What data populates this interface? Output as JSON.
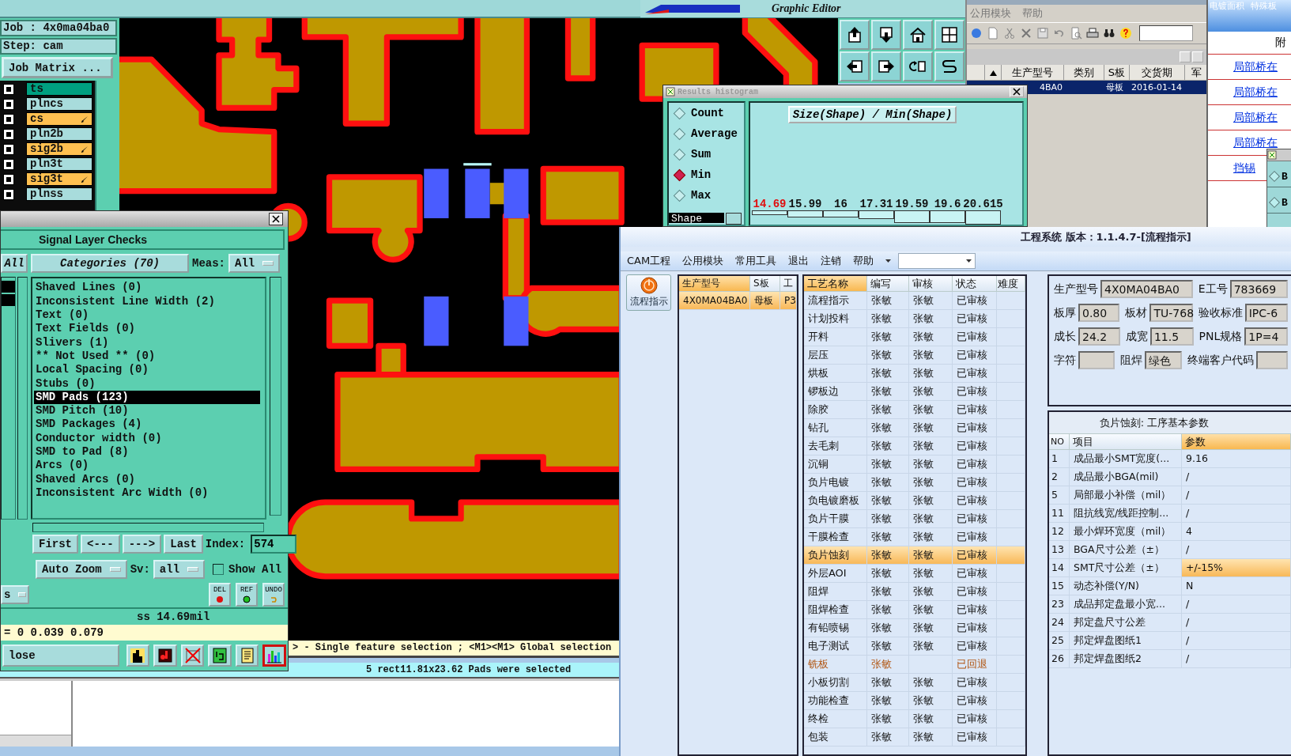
{
  "genesis": {
    "job": "Job : 4x0ma04ba0",
    "step": "Step: cam",
    "matrix_button": "Job Matrix ...",
    "layers": [
      {
        "name": "ts",
        "checked": true,
        "work": true,
        "affected": false
      },
      {
        "name": "plncs",
        "checked": true,
        "work": false,
        "affected": false
      },
      {
        "name": "cs",
        "checked": true,
        "work": false,
        "affected": true
      },
      {
        "name": "pln2b",
        "checked": true,
        "work": false,
        "affected": false
      },
      {
        "name": "sig2b",
        "checked": true,
        "work": false,
        "affected": true
      },
      {
        "name": "pln3t",
        "checked": true,
        "work": false,
        "affected": false
      },
      {
        "name": "sig3t",
        "checked": true,
        "work": false,
        "affected": true
      },
      {
        "name": "plnss",
        "checked": true,
        "work": false,
        "affected": false
      }
    ]
  },
  "editor": {
    "title": "Graphic Editor",
    "tools": [
      {
        "kind": "box-up"
      },
      {
        "kind": "box-down"
      },
      {
        "kind": "home"
      },
      {
        "kind": "grid"
      },
      {
        "kind": "box-left"
      },
      {
        "kind": "box-right"
      },
      {
        "kind": "rotate"
      },
      {
        "kind": "curve"
      }
    ]
  },
  "histogram": {
    "title": "Results histogram",
    "options": [
      {
        "label": "Count",
        "selected": false
      },
      {
        "label": "Average",
        "selected": false
      },
      {
        "label": "Sum",
        "selected": false
      },
      {
        "label": "Min",
        "selected": true
      },
      {
        "label": "Max",
        "selected": false
      }
    ],
    "list_item": "Shape",
    "heading": "Size(Shape) / Min(Shape)",
    "bars": [
      {
        "label": "14.69",
        "selected": true
      },
      {
        "label": "15.99",
        "selected": false
      },
      {
        "label": "16",
        "selected": false
      },
      {
        "label": "17.31",
        "selected": false
      },
      {
        "label": "19.59",
        "selected": false
      },
      {
        "label": "19.6",
        "selected": false
      },
      {
        "label": "20.615",
        "selected": false
      }
    ]
  },
  "checks": {
    "title": "Signal Layer Checks",
    "all_tab": "All",
    "categories_button": "Categories (70)",
    "meas_label": "Meas:",
    "meas_value": "All",
    "items": [
      {
        "label": "Shaved Lines (0)",
        "selected": false
      },
      {
        "label": "Inconsistent Line Width (2)",
        "selected": false
      },
      {
        "label": "Text (0)",
        "selected": false
      },
      {
        "label": "Text Fields (0)",
        "selected": false
      },
      {
        "label": "Slivers (1)",
        "selected": false
      },
      {
        "label": "** Not Used ** (0)",
        "selected": false
      },
      {
        "label": "Local Spacing (0)",
        "selected": false
      },
      {
        "label": "Stubs (0)",
        "selected": false
      },
      {
        "label": "SMD Pads (123)",
        "selected": true
      },
      {
        "label": "SMD Pitch (10)",
        "selected": false
      },
      {
        "label": "SMD Packages (4)",
        "selected": false
      },
      {
        "label": "Conductor width (0)",
        "selected": false
      },
      {
        "label": "SMD to Pad (8)",
        "selected": false
      },
      {
        "label": "Arcs (0)",
        "selected": false
      },
      {
        "label": "Shaved Arcs (0)",
        "selected": false
      },
      {
        "label": "Inconsistent Arc Width (0)",
        "selected": false
      }
    ],
    "nav": [
      "First",
      "<---",
      "--->",
      "Last"
    ],
    "index_label": "Index:",
    "index_value": "574",
    "zoom_value": "Auto Zoom",
    "sv_label": "Sv:",
    "sv_value": "all",
    "show_all": {
      "label": "Show All",
      "checked": false
    },
    "left_dropdown": "s",
    "actions": [
      {
        "label": "DEL",
        "kind": "delete"
      },
      {
        "label": "REF",
        "kind": "ref"
      },
      {
        "label": "UNDO",
        "kind": "undo"
      }
    ],
    "measure": "ss 14.69mil",
    "coords": "= 0 0.039 0.079",
    "close_button": "lose",
    "tools": [
      {
        "kind": "figure",
        "selected": false
      },
      {
        "kind": "layer",
        "selected": false
      },
      {
        "kind": "cross",
        "selected": false
      },
      {
        "kind": "numbered",
        "selected": false
      },
      {
        "kind": "notes",
        "selected": false
      },
      {
        "kind": "chart",
        "selected": true
      }
    ]
  },
  "status": {
    "hint": "> - Single feature selection ; <M1><M1> Global selection",
    "message": "5 rect11.81x23.62 Pads were selected"
  },
  "back_window": {
    "menu": [
      "公用模块",
      "帮助"
    ],
    "tools": [
      {
        "kind": "globe"
      },
      {
        "kind": "page"
      },
      {
        "kind": "scissors"
      },
      {
        "kind": "cross"
      },
      {
        "kind": "save"
      },
      {
        "kind": "undo"
      },
      {
        "kind": "preview"
      },
      {
        "kind": "print"
      },
      {
        "kind": "binoculars"
      },
      {
        "kind": "help"
      }
    ],
    "columns": [
      "生产型号",
      "类别",
      "S板",
      "交货期",
      "军"
    ],
    "row": {
      "selected": true,
      "cells": [
        "4BA0",
        null,
        "母板",
        "2016-01-14",
        null
      ]
    }
  },
  "side_window": {
    "tabs": [
      "电镀面积",
      "特殊板"
    ],
    "header": "附",
    "links": [
      "局部桥在",
      "局部桥在",
      "局部桥在",
      "局部桥在",
      "挡锡"
    ],
    "mini_options": [
      "B",
      "B"
    ]
  },
  "eng": {
    "title": "工程系统 版本：1.1.4.7-[流程指示]",
    "menu": [
      "CAM工程",
      "公用模块",
      "常用工具",
      "退出",
      "注销",
      "帮助"
    ],
    "side_button": "流程指示",
    "products": {
      "columns": [
        "生产型号",
        "S板",
        "工"
      ],
      "rows": [
        {
          "cells": [
            "4X0MA04BA0",
            "母板",
            "P3"
          ],
          "selected": true
        }
      ]
    },
    "processes": {
      "columns": [
        "工艺名称",
        "编写",
        "审核",
        "状态",
        "难度"
      ],
      "rows": [
        {
          "name": "流程指示",
          "writer": "张敏",
          "reviewer": "张敏",
          "status": "已审核",
          "returned": false,
          "selected": false
        },
        {
          "name": "计划投料",
          "writer": "张敏",
          "reviewer": "张敏",
          "status": "已审核",
          "returned": false,
          "selected": false
        },
        {
          "name": "开料",
          "writer": "张敏",
          "reviewer": "张敏",
          "status": "已审核",
          "returned": false,
          "selected": false
        },
        {
          "name": "层压",
          "writer": "张敏",
          "reviewer": "张敏",
          "status": "已审核",
          "returned": false,
          "selected": false
        },
        {
          "name": "烘板",
          "writer": "张敏",
          "reviewer": "张敏",
          "status": "已审核",
          "returned": false,
          "selected": false
        },
        {
          "name": "锣板边",
          "writer": "张敏",
          "reviewer": "张敏",
          "status": "已审核",
          "returned": false,
          "selected": false
        },
        {
          "name": "除胶",
          "writer": "张敏",
          "reviewer": "张敏",
          "status": "已审核",
          "returned": false,
          "selected": false
        },
        {
          "name": "钻孔",
          "writer": "张敏",
          "reviewer": "张敏",
          "status": "已审核",
          "returned": false,
          "selected": false
        },
        {
          "name": "去毛刺",
          "writer": "张敏",
          "reviewer": "张敏",
          "status": "已审核",
          "returned": false,
          "selected": false
        },
        {
          "name": "沉铜",
          "writer": "张敏",
          "reviewer": "张敏",
          "status": "已审核",
          "returned": false,
          "selected": false
        },
        {
          "name": "负片电镀",
          "writer": "张敏",
          "reviewer": "张敏",
          "status": "已审核",
          "returned": false,
          "selected": false
        },
        {
          "name": "负电镀磨板",
          "writer": "张敏",
          "reviewer": "张敏",
          "status": "已审核",
          "returned": false,
          "selected": false
        },
        {
          "name": "负片干膜",
          "writer": "张敏",
          "reviewer": "张敏",
          "status": "已审核",
          "returned": false,
          "selected": false
        },
        {
          "name": "干膜检查",
          "writer": "张敏",
          "reviewer": "张敏",
          "status": "已审核",
          "returned": false,
          "selected": false
        },
        {
          "name": "负片蚀刻",
          "writer": "张敏",
          "reviewer": "张敏",
          "status": "已审核",
          "returned": false,
          "selected": true
        },
        {
          "name": "外层AOI",
          "writer": "张敏",
          "reviewer": "张敏",
          "status": "已审核",
          "returned": false,
          "selected": false
        },
        {
          "name": "阻焊",
          "writer": "张敏",
          "reviewer": "张敏",
          "status": "已审核",
          "returned": false,
          "selected": false
        },
        {
          "name": "阻焊检查",
          "writer": "张敏",
          "reviewer": "张敏",
          "status": "已审核",
          "returned": false,
          "selected": false
        },
        {
          "name": "有铅喷锡",
          "writer": "张敏",
          "reviewer": "张敏",
          "status": "已审核",
          "returned": false,
          "selected": false
        },
        {
          "name": "电子测试",
          "writer": "张敏",
          "reviewer": "张敏",
          "status": "已审核",
          "returned": false,
          "selected": false
        },
        {
          "name": "铣板",
          "writer": "张敏",
          "status": "已回退",
          "returned": true,
          "selected": false
        },
        {
          "name": "小板切割",
          "writer": "张敏",
          "reviewer": "张敏",
          "status": "已审核",
          "returned": false,
          "selected": false
        },
        {
          "name": "功能检查",
          "writer": "张敏",
          "reviewer": "张敏",
          "status": "已审核",
          "returned": false,
          "selected": false
        },
        {
          "name": "终检",
          "writer": "张敏",
          "reviewer": "张敏",
          "status": "已审核",
          "returned": false,
          "selected": false
        },
        {
          "name": "包装",
          "writer": "张敏",
          "reviewer": "张敏",
          "status": "已审核",
          "returned": false,
          "selected": false
        }
      ]
    },
    "info": [
      [
        {
          "label": "生产型号",
          "value": "4X0MA04BA0"
        },
        {
          "label": "E工号",
          "value": "783669"
        }
      ],
      [
        {
          "label": "板厚",
          "value": "0.80"
        },
        {
          "label": "板材",
          "value": "TU-768"
        },
        {
          "label": "验收标准",
          "value": "IPC-6"
        }
      ],
      [
        {
          "label": "成长",
          "value": "24.2"
        },
        {
          "label": "成宽",
          "value": "11.5"
        },
        {
          "label": "PNL规格",
          "value": "1P=4"
        }
      ],
      [
        {
          "label": "字符"
        },
        {
          "label": "阻焊",
          "value": "绿色"
        },
        {
          "label": "终端客户代码"
        }
      ]
    ],
    "params": {
      "title": "负片蚀刻: 工序基本参数",
      "columns": [
        "NO",
        "项目",
        "参数"
      ],
      "rows": [
        {
          "no": "1",
          "item": "成品最小SMT宽度(...",
          "value": "9.16",
          "selected": false
        },
        {
          "no": "2",
          "item": "成品最小BGA(mil)",
          "value": "/",
          "selected": false
        },
        {
          "no": "5",
          "item": "局部最小补偿（mil）",
          "value": "/",
          "selected": false
        },
        {
          "no": "11",
          "item": "阻抗线宽/线距控制...",
          "value": "/",
          "selected": false
        },
        {
          "no": "12",
          "item": "最小焊环宽度（mil）",
          "value": "4",
          "selected": false
        },
        {
          "no": "13",
          "item": "BGA尺寸公差（±）",
          "value": "/",
          "selected": false
        },
        {
          "no": "14",
          "item": "SMT尺寸公差（±）",
          "value": "+/-15%",
          "selected": true
        },
        {
          "no": "15",
          "item": "动态补偿(Y/N)",
          "value": "N",
          "selected": false
        },
        {
          "no": "23",
          "item": "成品邦定盘最小宽...",
          "value": "/",
          "selected": false
        },
        {
          "no": "24",
          "item": "邦定盘尺寸公差",
          "value": "/",
          "selected": false
        },
        {
          "no": "25",
          "item": "邦定焊盘图纸1",
          "value": "/",
          "selected": false
        },
        {
          "no": "26",
          "item": "邦定焊盘图纸2",
          "value": "/",
          "selected": false
        }
      ]
    }
  }
}
